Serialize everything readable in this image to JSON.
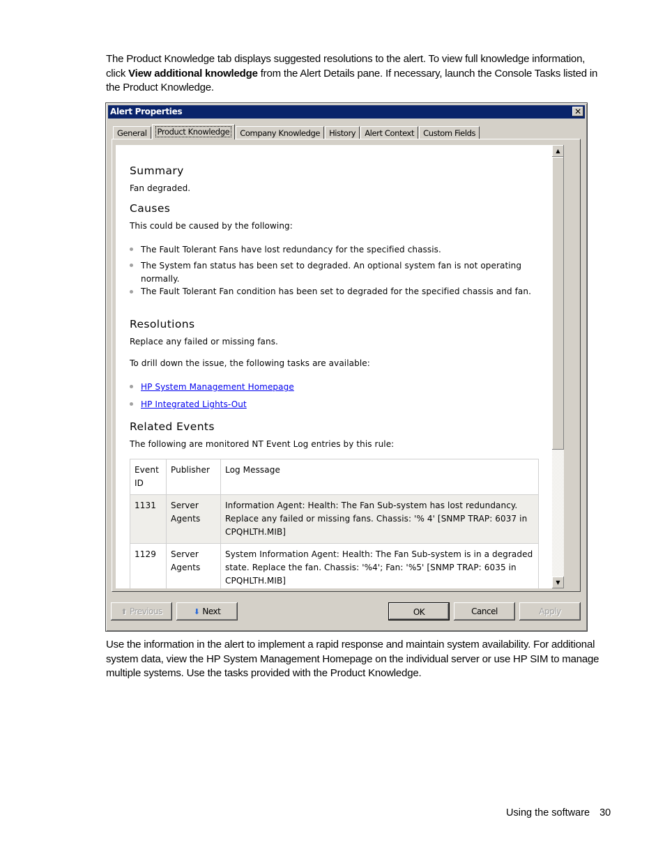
{
  "intro": {
    "before": "The Product Knowledge tab displays suggested resolutions to the alert. To view full knowledge information, click ",
    "bold": "View additional knowledge",
    "after": " from the Alert Details pane. If necessary, launch the Console Tasks listed in the Product Knowledge."
  },
  "dialog": {
    "title": "Alert Properties",
    "close_glyph": "✕",
    "tabs": [
      "General",
      "Product Knowledge",
      "Company Knowledge",
      "History",
      "Alert Context",
      "Custom Fields"
    ],
    "active_tab": "Product Knowledge",
    "knowledge": {
      "summary_heading": "Summary",
      "summary_text": "Fan degraded.",
      "causes_heading": "Causes",
      "causes_intro": "This could be caused by the following:",
      "causes": [
        "The Fault Tolerant Fans have lost redundancy for the specified chassis.",
        "The System fan status has been set to degraded. An optional system fan is not operating normally.",
        "The Fault Tolerant Fan condition has been set to degraded for the specified chassis and fan."
      ],
      "resolutions_heading": "Resolutions",
      "resolutions_text": "Replace any failed or missing fans.",
      "tasks_intro": "To drill down the issue, the following tasks are available:",
      "task_links": [
        "HP System Management Homepage",
        "HP Integrated Lights-Out"
      ],
      "related_heading": "Related Events",
      "related_intro": "The following are monitored NT Event Log entries by this rule:",
      "table": {
        "headers": [
          "Event ID",
          "Publisher",
          "Log Message"
        ],
        "rows": [
          [
            "1131",
            "Server Agents",
            "Information Agent: Health: The Fan Sub-system has lost redundancy. Replace any failed or missing fans. Chassis: '% 4' [SNMP TRAP: 6037 in CPQHLTH.MIB]"
          ],
          [
            "1129",
            "Server Agents",
            "System Information Agent: Health: The Fan Sub-system is in a degraded state. Replace the fan. Chassis: '%4'; Fan: '%5' [SNMP TRAP: 6035 in CPQHLTH.MIB]"
          ]
        ]
      }
    },
    "scroll_position_fraction": 0.0,
    "buttons": {
      "previous": "Previous",
      "next": "Next",
      "ok": "OK",
      "cancel": "Cancel",
      "apply": "Apply"
    }
  },
  "outro": "Use the information in the alert to implement a rapid response and maintain system availability. For additional system data, view the HP System Management Homepage on the individual server or use HP SIM to manage multiple systems. Use the tasks provided with the Product Knowledge.",
  "footer": {
    "section": "Using the software",
    "page": "30"
  }
}
